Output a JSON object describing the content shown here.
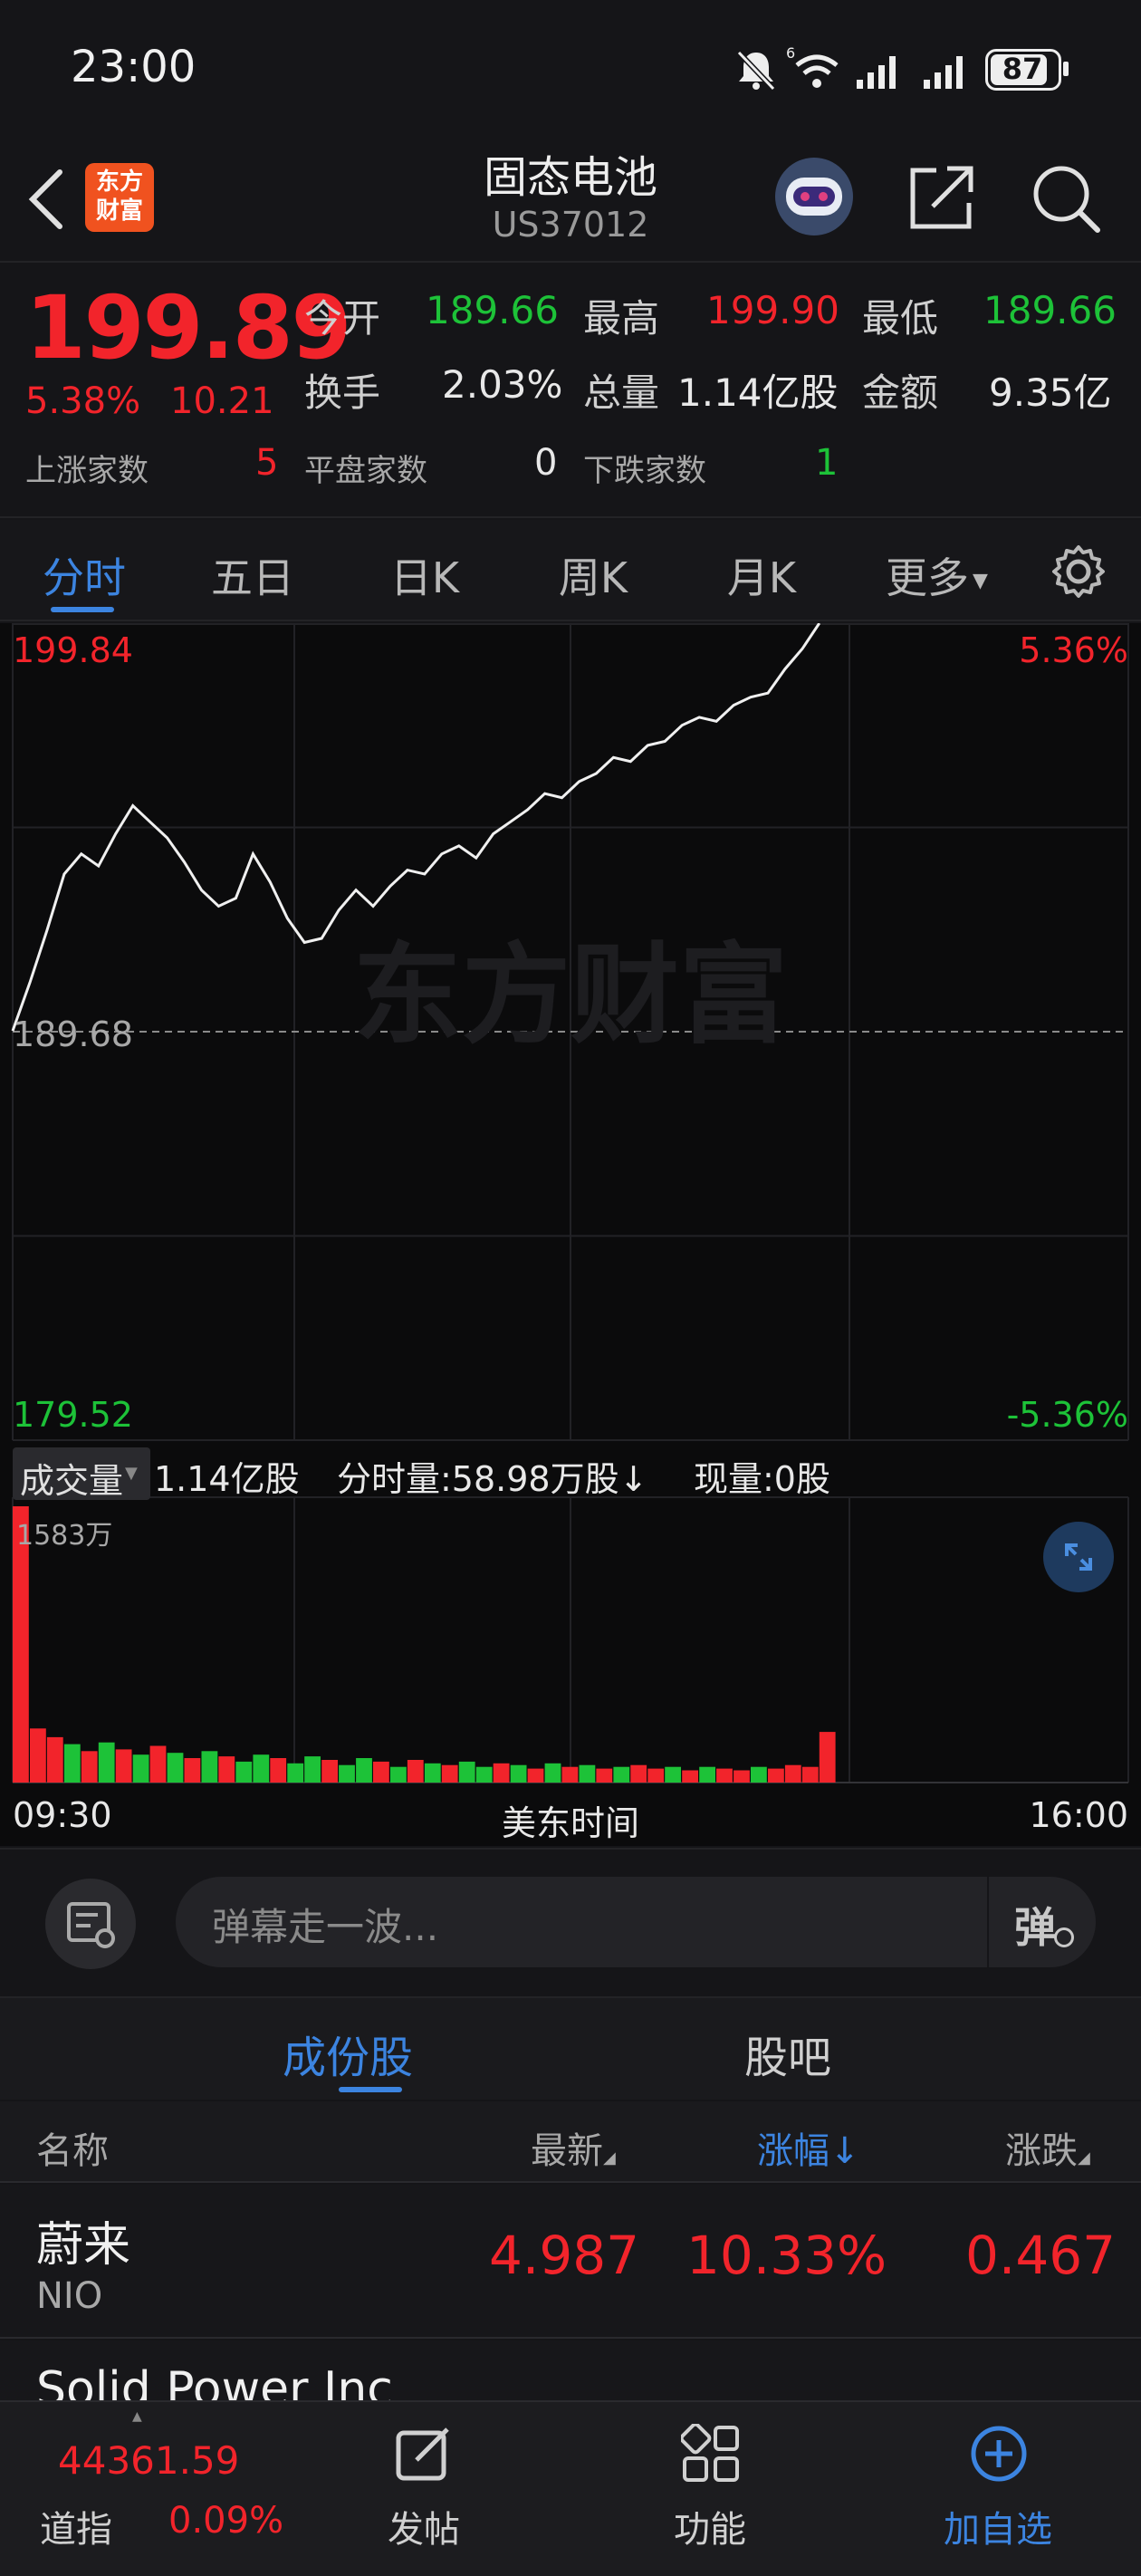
{
  "status_bar": {
    "time": "23:00",
    "battery": "87",
    "wifi_badge": "6"
  },
  "header": {
    "logo_text_line1": "东方",
    "logo_text_line2": "财富",
    "title": "固态电池",
    "code": "US37012"
  },
  "quote": {
    "price": "199.89",
    "change_pct": "5.38%",
    "change_amt": "10.21",
    "open_label": "今开",
    "open": "189.66",
    "high_label": "最高",
    "high": "199.90",
    "low_label": "最低",
    "low": "189.66",
    "turnover_label": "换手",
    "turnover": "2.03%",
    "volume_label": "总量",
    "volume": "1.14亿股",
    "amount_label": "金额",
    "amount": "9.35亿",
    "up_label": "上涨家数",
    "up": "5",
    "flat_label": "平盘家数",
    "flat": "0",
    "down_label": "下跌家数",
    "down": "1"
  },
  "tabs": [
    "分时",
    "五日",
    "日K",
    "周K",
    "月K",
    "更多"
  ],
  "chart": {
    "max_price": "199.84",
    "max_pct": "5.36%",
    "mid_price": "189.68",
    "min_price": "179.52",
    "min_pct": "-5.36%",
    "watermark": "东方财富",
    "vol_selector": "成交量",
    "vol_total": "1.14亿股",
    "vol_minute": "分时量:58.98万股↓",
    "vol_now": "现量:0股",
    "vol_max": "1583万",
    "time_start": "09:30",
    "time_mid": "美东时间",
    "time_end": "16:00"
  },
  "chart_data": {
    "type": "line",
    "title": "",
    "xlabel": "美东时间",
    "x_ticks": [
      "09:30",
      "16:00"
    ],
    "ylabel": "",
    "ylim": [
      179.52,
      199.84
    ],
    "reference_line": 189.68,
    "series": [
      {
        "values": [
          189.7,
          190.9,
          192.2,
          193.6,
          194.1,
          193.8,
          194.6,
          195.3,
          194.9,
          194.5,
          193.9,
          193.2,
          192.8,
          193.0,
          194.1,
          193.4,
          192.5,
          191.9,
          192.0,
          192.7,
          193.2,
          192.8,
          193.3,
          193.7,
          193.6,
          194.1,
          194.3,
          194.0,
          194.6,
          194.9,
          195.2,
          195.6,
          195.5,
          195.9,
          196.1,
          196.5,
          196.4,
          196.8,
          196.9,
          197.3,
          197.5,
          197.4,
          197.8,
          198.0,
          198.1,
          198.7,
          199.2,
          199.89
        ]
      }
    ],
    "volume_ylim": [
      0,
      1583
    ],
    "volume_unit": "万",
    "volume_values": [
      1583,
      310,
      260,
      220,
      180,
      230,
      190,
      160,
      210,
      170,
      140,
      180,
      150,
      120,
      160,
      140,
      110,
      150,
      130,
      100,
      140,
      120,
      90,
      130,
      110,
      100,
      120,
      90,
      110,
      100,
      80,
      110,
      90,
      100,
      80,
      90,
      100,
      80,
      90,
      70,
      90,
      80,
      70,
      90,
      80,
      100,
      90,
      290
    ],
    "volume_colors": [
      "r",
      "r",
      "r",
      "g",
      "r",
      "g",
      "r",
      "g",
      "r",
      "g",
      "r",
      "g",
      "r",
      "g",
      "g",
      "r",
      "g",
      "g",
      "r",
      "g",
      "g",
      "r",
      "g",
      "r",
      "g",
      "r",
      "g",
      "g",
      "r",
      "g",
      "r",
      "g",
      "r",
      "g",
      "r",
      "g",
      "r",
      "r",
      "g",
      "r",
      "g",
      "r",
      "r",
      "g",
      "r",
      "r",
      "r",
      "r"
    ]
  },
  "danmaku": {
    "placeholder": "弹幕走一波...",
    "send_label": "弹"
  },
  "subtabs": [
    "成份股",
    "股吧"
  ],
  "list": {
    "col_name": "名称",
    "col_latest": "最新",
    "col_pct": "涨幅↓",
    "col_change": "涨跌",
    "rows": [
      {
        "name": "蔚来",
        "code": "NIO",
        "latest": "4.987",
        "pct": "10.33%",
        "change": "0.467"
      },
      {
        "name": "Solid Power Inc",
        "code": "",
        "latest": "",
        "pct": "",
        "change": ""
      }
    ]
  },
  "bottom_bar": {
    "index_value": "44361.59",
    "index_name": "道指",
    "index_pct": "0.09%",
    "post": "发帖",
    "function": "功能",
    "add_watch": "加自选"
  },
  "colors": {
    "up": "#f2242b",
    "down": "#1dc238",
    "accent": "#3c84e0",
    "background": "#151518"
  }
}
